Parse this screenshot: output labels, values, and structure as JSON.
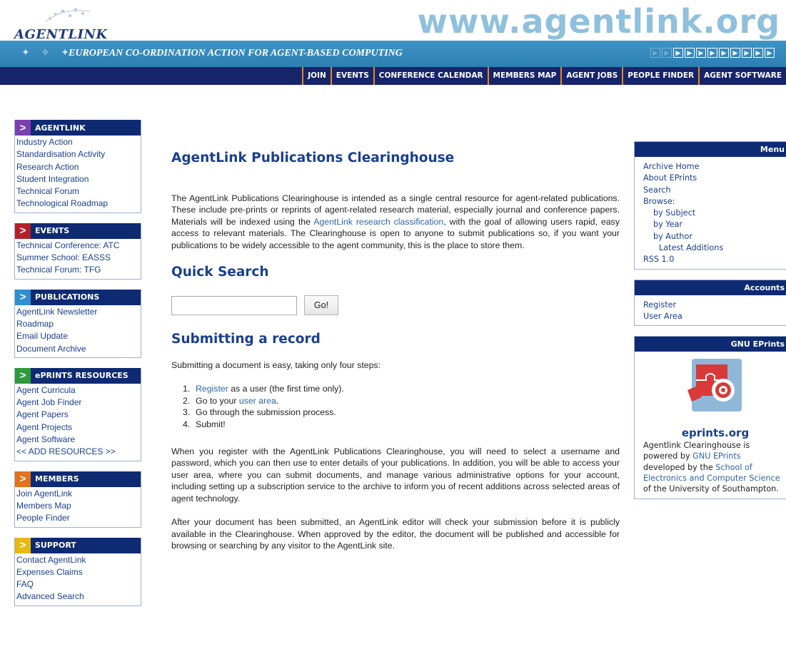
{
  "header": {
    "logo_text": "AGENTLINK",
    "url_banner": "www.agentlink.org",
    "tagline": "EUROPEAN CO-ORDINATION ACTION FOR AGENT-BASED COMPUTING",
    "nav": [
      "JOIN",
      "EVENTS",
      "CONFERENCE CALENDAR",
      "MEMBERS MAP",
      "AGENT JOBS",
      "PEOPLE FINDER",
      "AGENT SOFTWARE"
    ],
    "colors": {
      "band": "#2e7fb3",
      "navbar": "#16246a",
      "nav_divider": "#e58b1a"
    }
  },
  "sidebar": {
    "sections": [
      {
        "title": "AGENTLINK",
        "arrow_color": "#7a3fb0",
        "items": [
          "Industry Action",
          "Standardisation Activity",
          "Research Action",
          "Student Integration",
          "Technical Forum",
          "Technological Roadmap"
        ]
      },
      {
        "title": "EVENTS",
        "arrow_color": "#b3202a",
        "items": [
          "Technical Conference: ATC",
          "Summer School: EASSS",
          "Technical Forum: TFG"
        ]
      },
      {
        "title": "PUBLICATIONS",
        "arrow_color": "#2f8fd0",
        "items": [
          "AgentLink Newsletter",
          "Roadmap",
          "Email Update",
          "Document Archive"
        ]
      },
      {
        "title": "ePRINTS RESOURCES",
        "arrow_color": "#2e9a3a",
        "items": [
          "Agent Curricula",
          "Agent Job Finder",
          "Agent Papers",
          "Agent Projects",
          "Agent Software",
          "<< ADD RESOURCES >>"
        ]
      },
      {
        "title": "MEMBERS",
        "arrow_color": "#e0731c",
        "items": [
          "Join AgentLink",
          "Members Map",
          "People Finder"
        ]
      },
      {
        "title": "SUPPORT",
        "arrow_color": "#e8b914",
        "items": [
          "Contact AgentLink",
          "Expenses Claims",
          "FAQ",
          "Advanced Search"
        ]
      }
    ]
  },
  "main": {
    "title": "AgentLink Publications Clearinghouse",
    "intro_1": "The AgentLink Publications Clearinghouse is intended as a single central resource for agent-related publications. These include pre-prints or reprints of agent-related research material, especially journal and conference papers. Materials will be indexed using the",
    "intro_link": "AgentLink research classification",
    "intro_2": ", with the goal of allowing users rapid, easy access to relevant materials. The Clearinghouse is open to anyone to submit publications so, if you want your publications to be widely accessible to the agent community, this is the place to store them.",
    "quick_search": {
      "heading": "Quick Search",
      "input_value": "",
      "button_label": "Go!"
    },
    "submitting": {
      "heading": "Submitting a record",
      "lead": "Submitting a document is easy, taking only four steps:",
      "steps": [
        {
          "num": "1.",
          "link": "Register",
          "text": " as a user (the first time only)."
        },
        {
          "num": "2.",
          "text": "Go to your ",
          "link": "user area",
          "text_after": "."
        },
        {
          "num": "3.",
          "text": "Go through the submission process."
        },
        {
          "num": "4.",
          "text": "Submit!"
        }
      ],
      "para_1": "When you register with the AgentLink Publications Clearinghouse, you will need to select a username and password, which you can then use to enter details of your publications. In addition, you will be able to access your user area, where you can submit documents, and manage various administrative options for your account, including setting up a subscription service to the archive to inform you of recent additions across selected areas of agent technology.",
      "para_2": "After your document has been submitted, an AgentLink editor will check your submission before it is publicly available in the Clearinghouse. When approved by the editor, the document will be published and accessible for browsing or searching by any visitor to the AgentLink site."
    }
  },
  "right": {
    "menu": {
      "title": "Menu",
      "items": [
        "Archive Home",
        "About EPrints",
        "Search",
        "Browse:"
      ],
      "browse_items": [
        "by Subject",
        "by Year",
        "by Author"
      ],
      "latest": "Latest Additions",
      "rss": "RSS 1.0"
    },
    "accounts": {
      "title": "Accounts",
      "items": [
        "Register",
        "User Area"
      ]
    },
    "gnu": {
      "title": "GNU EPrints",
      "logo_caption": "eprints.org",
      "text_1": "Agentlink Clearinghouse is powered by ",
      "link_1": "GNU EPrints",
      "text_2": " developed by the ",
      "link_2": "School of Electronics and Computer Science",
      "text_3": " of the University of Southampton."
    }
  }
}
